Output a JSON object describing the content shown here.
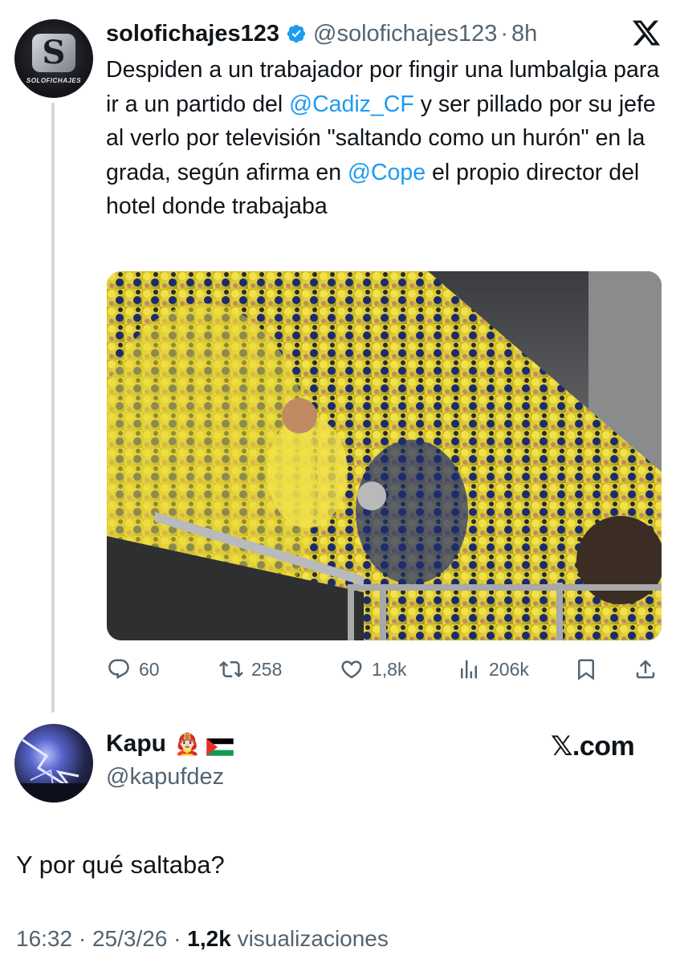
{
  "quoted_tweet": {
    "display_name": "solofichajes123",
    "handle": "@solofichajes123",
    "time": "8h",
    "avatar_text": "SOLOFICHAJES",
    "text_parts": [
      "Despiden a un trabajador por fingir una lumbalgia para ir a un partido del ",
      "@Cadiz_CF",
      " y ser pillado por su jefe al verlo por televisión \"saltando como un hurón\" en la grada, según afirma en ",
      "@Cope",
      " el propio director del hotel donde trabajaba"
    ],
    "stats": {
      "replies": "60",
      "reposts": "258",
      "likes": "1,8k",
      "views": "206k"
    }
  },
  "reply": {
    "display_name": "Kapu",
    "emoji": "👨🏻‍🚒",
    "handle": "@kapufdez",
    "watermark": "𝕏.com",
    "text": "Y por qué saltaba?",
    "time": "16:32",
    "date": "25/3/26",
    "views": "1,2k",
    "views_label": "visualizaciones",
    "separator": "·"
  },
  "colors": {
    "link": "#1d9bf0",
    "secondary_text": "#536471",
    "verified": "#1d9bf0"
  }
}
